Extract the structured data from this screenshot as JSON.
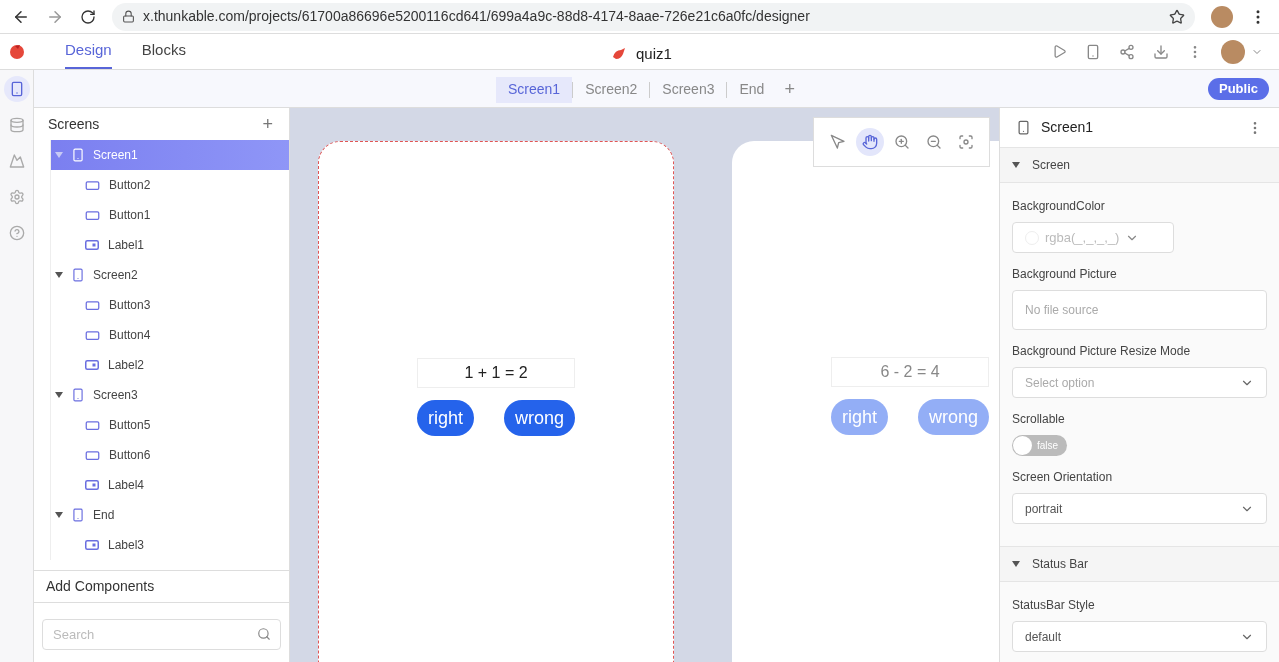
{
  "browser": {
    "url": "x.thunkable.com/projects/61700a86696e5200116cd641/699a4a9c-88d8-4174-8aae-726e21c6a0fc/designer"
  },
  "header": {
    "tabs": [
      {
        "label": "Design",
        "selected": true
      },
      {
        "label": "Blocks",
        "selected": false
      }
    ],
    "project_name": "quiz1"
  },
  "screen_tabs": {
    "tabs": [
      {
        "label": "Screen1",
        "selected": true
      },
      {
        "label": "Screen2",
        "selected": false
      },
      {
        "label": "Screen3",
        "selected": false
      },
      {
        "label": "End",
        "selected": false
      }
    ],
    "add": "+",
    "visibility": "Public"
  },
  "rail": [
    {
      "kind": "phone",
      "selected": true
    },
    {
      "kind": "database",
      "selected": false
    },
    {
      "kind": "image",
      "selected": false
    },
    {
      "kind": "settings",
      "selected": false
    },
    {
      "kind": "help",
      "selected": false
    }
  ],
  "screens_panel": {
    "title": "Screens",
    "add": "+",
    "tree": [
      {
        "name": "Screen1",
        "kind": "screen",
        "selected": true,
        "expanded": true,
        "children": [
          {
            "name": "Button2",
            "kind": "button",
            "selected": false
          },
          {
            "name": "Button1",
            "kind": "button",
            "selected": false
          },
          {
            "name": "Label1",
            "kind": "label",
            "selected": false
          }
        ]
      },
      {
        "name": "Screen2",
        "kind": "screen",
        "selected": false,
        "expanded": true,
        "children": [
          {
            "name": "Button3",
            "kind": "button",
            "selected": false
          },
          {
            "name": "Button4",
            "kind": "button",
            "selected": false
          },
          {
            "name": "Label2",
            "kind": "label",
            "selected": false
          }
        ]
      },
      {
        "name": "Screen3",
        "kind": "screen",
        "selected": false,
        "expanded": true,
        "children": [
          {
            "name": "Button5",
            "kind": "button",
            "selected": false
          },
          {
            "name": "Button6",
            "kind": "button",
            "selected": false
          },
          {
            "name": "Label4",
            "kind": "label",
            "selected": false
          }
        ]
      },
      {
        "name": "End",
        "kind": "screen",
        "selected": false,
        "expanded": true,
        "children": [
          {
            "name": "Label3",
            "kind": "label",
            "selected": false
          }
        ]
      }
    ]
  },
  "add_components": {
    "title": "Add Components",
    "search": {
      "placeholder": "Search"
    }
  },
  "canvas": {
    "tools": [
      {
        "kind": "pointer",
        "selected": false
      },
      {
        "kind": "hand",
        "selected": true
      },
      {
        "kind": "zoom_in",
        "selected": false
      },
      {
        "kind": "zoom_out",
        "selected": false
      },
      {
        "kind": "fit",
        "selected": false
      }
    ],
    "phones": [
      {
        "selected": true,
        "label": "1 + 1 = 2",
        "buttons": [
          "right",
          "wrong"
        ]
      },
      {
        "selected": false,
        "label": "6 - 2 = 4",
        "buttons": [
          "right",
          "wrong"
        ]
      }
    ]
  },
  "properties": {
    "title": "Screen1",
    "sections": [
      {
        "title": "Screen",
        "expanded": true,
        "fields": [
          {
            "label": "BackgroundColor",
            "kind": "color",
            "placeholder": "rgba(_,_,_,_)"
          },
          {
            "label": "Background Picture",
            "kind": "text",
            "placeholder": "No file source"
          },
          {
            "label": "Background Picture Resize Mode",
            "kind": "select",
            "placeholder": "Select option"
          },
          {
            "label": "Scrollable",
            "kind": "switch",
            "on": false,
            "value": "false"
          },
          {
            "label": "Screen Orientation",
            "kind": "select",
            "value": "portrait"
          }
        ]
      },
      {
        "title": "Status Bar",
        "expanded": true,
        "fields": [
          {
            "label": "StatusBar Style",
            "kind": "select",
            "value": "default"
          }
        ]
      }
    ]
  }
}
